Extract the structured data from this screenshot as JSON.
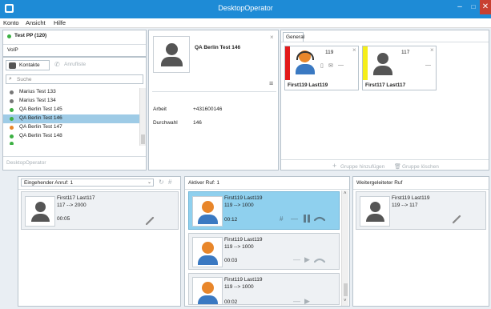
{
  "window": {
    "title": "DesktopOperator",
    "min_label": "–",
    "max_label": "□",
    "close_label": "✕"
  },
  "menu": {
    "items": [
      "Konto",
      "Ansicht",
      "Hilfe"
    ]
  },
  "account": {
    "name": "Test PP (120)",
    "line": "VoIP",
    "status_color": "#3cb043"
  },
  "tabs": {
    "contacts": "Kontakte",
    "calls": "Anrufliste"
  },
  "search": {
    "placeholder": "Suche"
  },
  "contacts": [
    {
      "name": "Marius Test 133",
      "status": "#777777"
    },
    {
      "name": "Marius Test 134",
      "status": "#777777"
    },
    {
      "name": "QA Berlin Test 145",
      "status": "#3cb043"
    },
    {
      "name": "QA Berlin Test 146",
      "status": "#3cb043",
      "selected": true
    },
    {
      "name": "QA Berlin Test 147",
      "status": "#e8862a"
    },
    {
      "name": "QA Berlin Test 148",
      "status": "#3cb043"
    }
  ],
  "footer": {
    "left": "DesktopOperator"
  },
  "detail": {
    "name": "QA Berlin Test 146",
    "rows": [
      {
        "label": "Arbeit",
        "value": "+431600146"
      },
      {
        "label": "Durchwahl",
        "value": "146"
      }
    ]
  },
  "favorites": {
    "tab": "General",
    "cards": [
      {
        "name": "First119 Last119",
        "ext": "119",
        "bar_color": "#e31b1b",
        "avatar": "operator"
      },
      {
        "name": "First117 Last117",
        "ext": "117",
        "bar_color": "#f5ee1a",
        "avatar": "person"
      }
    ],
    "add_group": "Gruppe hinzufügen",
    "delete_group": "Gruppe löschen"
  },
  "incoming": {
    "title": "Eingehender Anruf: 1",
    "calls": [
      {
        "name": "First117 Last117",
        "route": "117 --> 2000",
        "time": "00:05"
      }
    ]
  },
  "active": {
    "title": "Aktiver Ruf: 1",
    "calls": [
      {
        "name": "First119 Last119",
        "route": "119 --> 1000",
        "time": "00:12",
        "active": true
      },
      {
        "name": "First119 Last119",
        "route": "119 --> 1000",
        "time": "00:03"
      },
      {
        "name": "First119 Last119",
        "route": "119 --> 1000",
        "time": "00:02"
      }
    ]
  },
  "forwarded": {
    "title": "Weitergeleiteter Ruf",
    "calls": [
      {
        "name": "First119 Last119",
        "route": "119 --> 117"
      }
    ]
  },
  "colors": {
    "titlebar": "#1e8bd6",
    "selection": "#9ecbe6",
    "active_call": "#8fd0ee",
    "close": "#c84031"
  }
}
